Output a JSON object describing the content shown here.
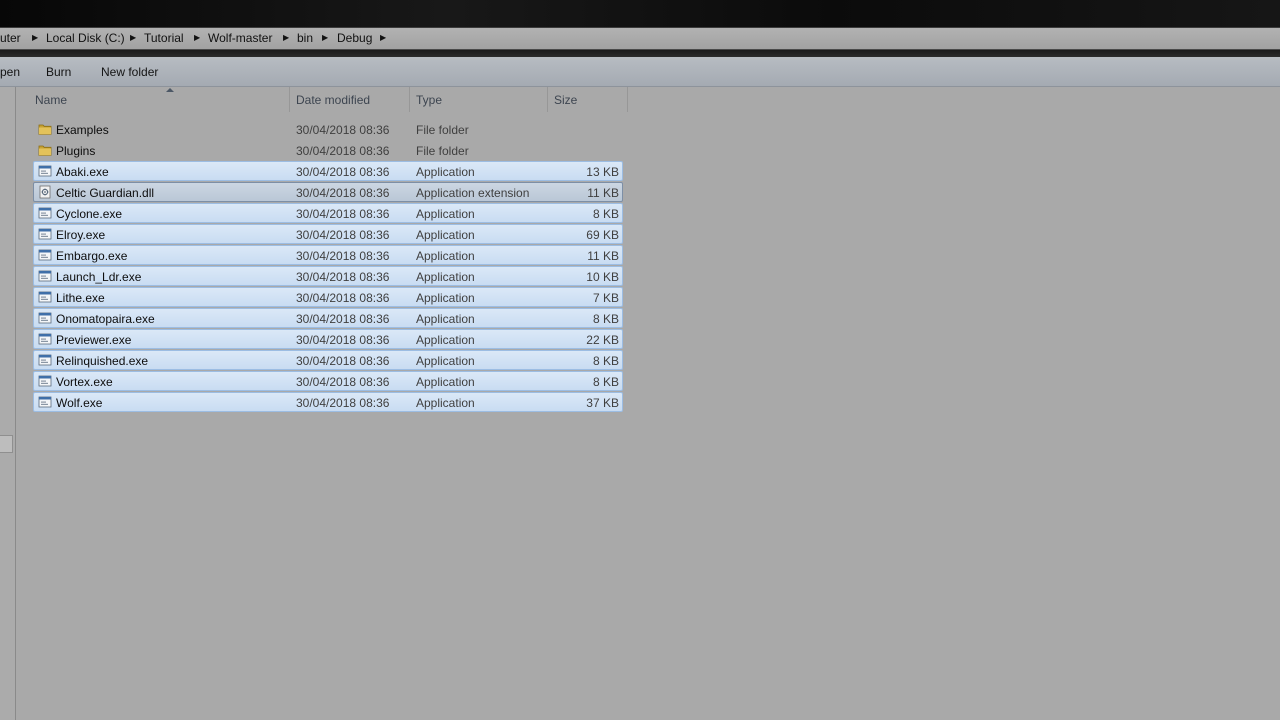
{
  "address": {
    "crumbs": [
      "uter",
      "Local Disk (C:)",
      "Tutorial",
      "Wolf-master",
      "bin",
      "Debug"
    ]
  },
  "toolbar": {
    "open_label": "pen",
    "burn_label": "Burn",
    "new_folder_label": "New folder"
  },
  "columns": {
    "name": "Name",
    "date": "Date modified",
    "type": "Type",
    "size": "Size"
  },
  "files": [
    {
      "name": "Examples",
      "date": "30/04/2018 08:36",
      "type": "File folder",
      "size": "",
      "icon": "folder-icon",
      "state": "normal"
    },
    {
      "name": "Plugins",
      "date": "30/04/2018 08:36",
      "type": "File folder",
      "size": "",
      "icon": "folder-icon",
      "state": "normal"
    },
    {
      "name": "Abaki.exe",
      "date": "30/04/2018 08:36",
      "type": "Application",
      "size": "13 KB",
      "icon": "application-icon",
      "state": "selected"
    },
    {
      "name": "Celtic Guardian.dll",
      "date": "30/04/2018 08:36",
      "type": "Application extension",
      "size": "11 KB",
      "icon": "dll-icon",
      "state": "hot"
    },
    {
      "name": "Cyclone.exe",
      "date": "30/04/2018 08:36",
      "type": "Application",
      "size": "8 KB",
      "icon": "application-icon",
      "state": "selected"
    },
    {
      "name": "Elroy.exe",
      "date": "30/04/2018 08:36",
      "type": "Application",
      "size": "69 KB",
      "icon": "application-icon",
      "state": "selected"
    },
    {
      "name": "Embargo.exe",
      "date": "30/04/2018 08:36",
      "type": "Application",
      "size": "11 KB",
      "icon": "application-icon",
      "state": "selected"
    },
    {
      "name": "Launch_Ldr.exe",
      "date": "30/04/2018 08:36",
      "type": "Application",
      "size": "10 KB",
      "icon": "application-icon",
      "state": "selected"
    },
    {
      "name": "Lithe.exe",
      "date": "30/04/2018 08:36",
      "type": "Application",
      "size": "7 KB",
      "icon": "application-icon",
      "state": "selected"
    },
    {
      "name": "Onomatopaira.exe",
      "date": "30/04/2018 08:36",
      "type": "Application",
      "size": "8 KB",
      "icon": "application-icon",
      "state": "selected"
    },
    {
      "name": "Previewer.exe",
      "date": "30/04/2018 08:36",
      "type": "Application",
      "size": "22 KB",
      "icon": "application-icon",
      "state": "selected"
    },
    {
      "name": "Relinquished.exe",
      "date": "30/04/2018 08:36",
      "type": "Application",
      "size": "8 KB",
      "icon": "application-icon",
      "state": "selected"
    },
    {
      "name": "Vortex.exe",
      "date": "30/04/2018 08:36",
      "type": "Application",
      "size": "8 KB",
      "icon": "application-icon",
      "state": "selected"
    },
    {
      "name": "Wolf.exe",
      "date": "30/04/2018 08:36",
      "type": "Application",
      "size": "37 KB",
      "icon": "application-icon",
      "state": "selected"
    }
  ]
}
